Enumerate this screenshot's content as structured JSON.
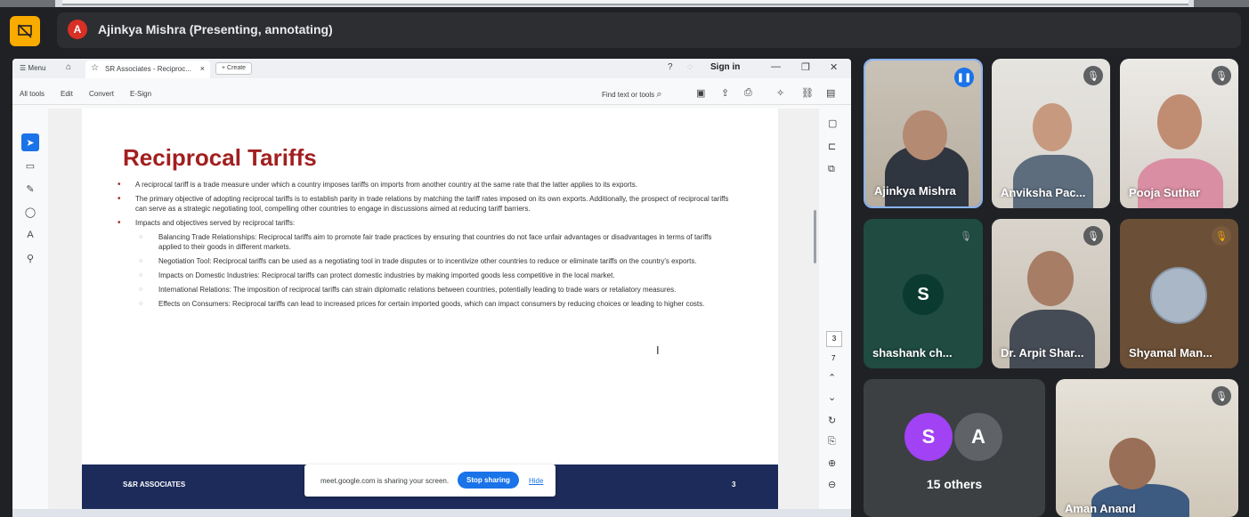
{
  "meet": {
    "presenter_initial": "A",
    "presenter_label": "Ajinkya Mishra (Presenting, annotating)"
  },
  "browser": {
    "menu_label": "Menu",
    "tab_title": "SR Associates - Reciproc...",
    "create_label": "Create",
    "signin_label": "Sign in",
    "toolbar": {
      "all_tools": "All tools",
      "edit": "Edit",
      "convert": "Convert",
      "esign": "E-Sign",
      "find": "Find text or tools"
    }
  },
  "document": {
    "title": "Reciprocal Tariffs",
    "bullets": [
      "A reciprocal tariff is a trade measure under which a country imposes tariffs on imports from another country at the same rate that the latter applies to its exports.",
      "The primary objective of adopting reciprocal tariffs is to establish parity in trade relations by matching the tariff rates imposed on its own exports. Additionally, the prospect of reciprocal tariffs can serve as a strategic negotiating tool, compelling other countries to engage in discussions aimed at reducing tariff barriers.",
      "Impacts and objectives served by reciprocal tariffs:"
    ],
    "subpoints": [
      "Balancing Trade Relationships: Reciprocal tariffs aim to promote fair trade practices by ensuring that countries do not face unfair advantages or disadvantages in terms of tariffs applied to their goods in different markets.",
      "Negotiation Tool: Reciprocal tariffs can be used as a negotiating tool in trade disputes or to incentivize other countries to reduce or eliminate tariffs on the country's exports.",
      "Impacts on Domestic Industries: Reciprocal tariffs can protect domestic industries by making imported goods less competitive in the local market.",
      "International Relations: The imposition of reciprocal tariffs can strain diplomatic relations between countries, potentially leading to trade wars or retaliatory measures.",
      "Effects on Consumers: Reciprocal tariffs can lead to increased prices for certain imported goods, which can impact consumers by reducing choices or leading to higher costs."
    ],
    "footer_left": "S&R ASSOCIATES",
    "footer_page": "3",
    "current_page": "3",
    "total_pages": "7"
  },
  "share_banner": {
    "message": "meet.google.com is sharing your screen.",
    "stop": "Stop sharing",
    "hide": "Hide"
  },
  "participants": [
    {
      "name": "Ajinkya Mishra"
    },
    {
      "name": "Anviksha Pac..."
    },
    {
      "name": "Pooja Suthar"
    },
    {
      "name": "shashank ch...",
      "initial": "S"
    },
    {
      "name": "Dr. Arpit Shar..."
    },
    {
      "name": "Shyamal Man..."
    },
    {
      "name": "Aman Anand"
    }
  ],
  "others": {
    "label": "15 others",
    "initial_1": "S",
    "initial_2": "A"
  },
  "colors": {
    "title_red": "#a21f1f",
    "footer_navy": "#1c2b5a",
    "accent_blue": "#1a73e8",
    "present_yellow": "#f9ab00"
  }
}
